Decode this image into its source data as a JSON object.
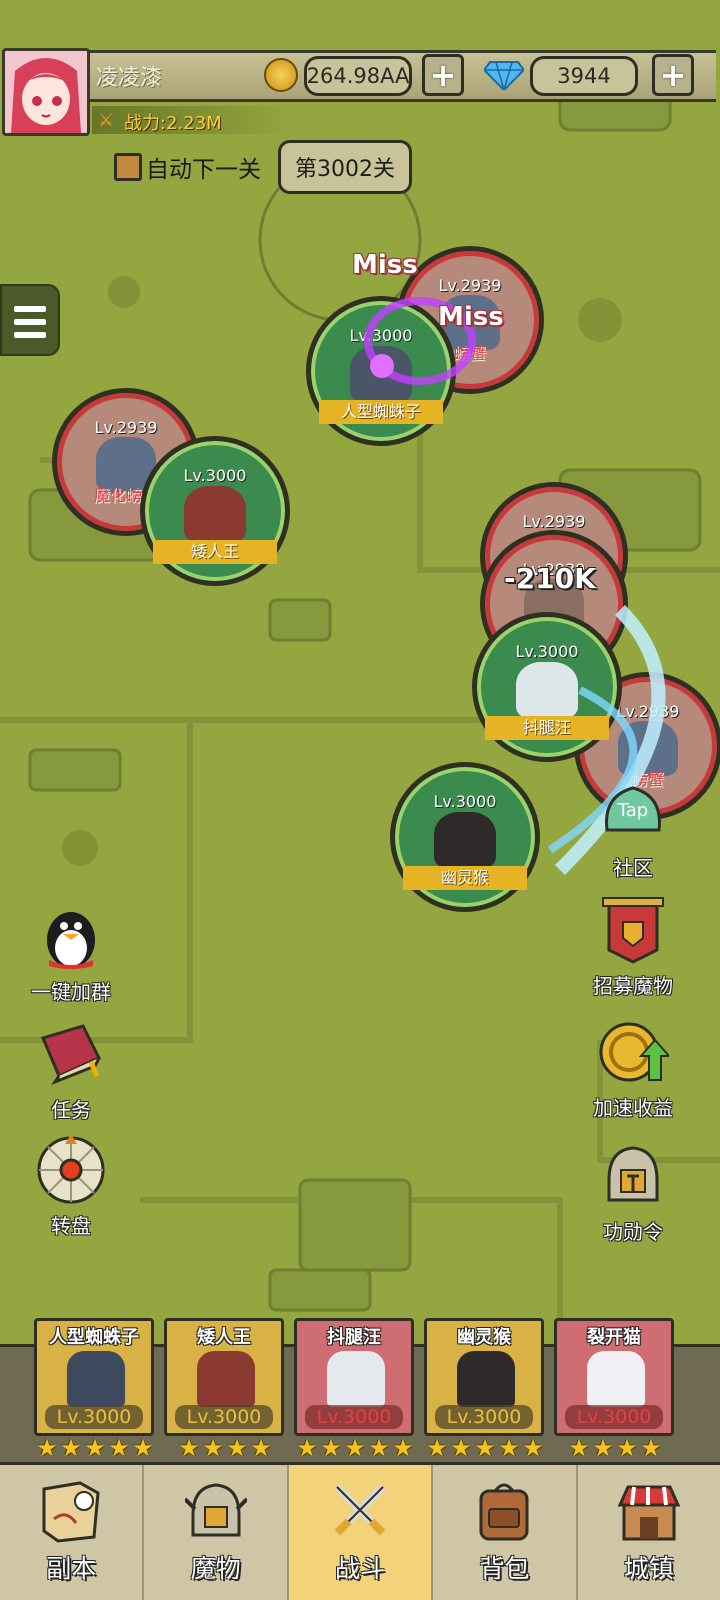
{
  "player": {
    "name": "凌凌漆",
    "power": "战力:2.23M"
  },
  "currency": {
    "gold": "264.98AA",
    "gems": "3944"
  },
  "stage": {
    "auto_next_label": "自动下一关",
    "auto_next_checked": true,
    "current": "第3002关"
  },
  "battle": {
    "allies": [
      {
        "level": "Lv.3000",
        "name": "人型蜘蛛子"
      },
      {
        "level": "Lv.3000",
        "name": "矮人王"
      },
      {
        "level": "Lv.3000",
        "name": "抖腿汪"
      },
      {
        "level": "Lv.3000",
        "name": "幽灵猴"
      }
    ],
    "enemies": [
      {
        "level": "Lv.2939",
        "name": "魔化螃蟹"
      },
      {
        "level": "Lv.2939",
        "name": "螃蟹"
      },
      {
        "level": "Lv.2939",
        "name": ""
      },
      {
        "level": "Lv.2939",
        "name": ""
      },
      {
        "level": "Lv.2939",
        "name": "螃蟹"
      }
    ],
    "float_texts": {
      "miss_1": "Miss",
      "miss_2": "Miss",
      "damage": "-210K"
    }
  },
  "side_left": [
    {
      "label": "一键加群",
      "icon": "penguin-icon"
    },
    {
      "label": "任务",
      "icon": "book-icon"
    },
    {
      "label": "转盘",
      "icon": "wheel-icon"
    }
  ],
  "side_right": [
    {
      "label": "社区",
      "icon": "tap-bubble-icon",
      "badge": "Tap"
    },
    {
      "label": "招募魔物",
      "icon": "banner-icon"
    },
    {
      "label": "加速收益",
      "icon": "coin-boost-icon"
    },
    {
      "label": "功勋令",
      "icon": "helmet-icon"
    }
  ],
  "team": [
    {
      "name": "人型蜘蛛子",
      "level": "Lv.3000",
      "stars": 5
    },
    {
      "name": "矮人王",
      "level": "Lv.3000",
      "stars": 4
    },
    {
      "name": "抖腿汪",
      "level": "Lv.3000",
      "stars": 5
    },
    {
      "name": "幽灵猴",
      "level": "Lv.3000",
      "stars": 5
    },
    {
      "name": "裂开猫",
      "level": "Lv.3000",
      "stars": 4
    }
  ],
  "nav": [
    {
      "label": "副本",
      "icon": "map-icon",
      "active": false
    },
    {
      "label": "魔物",
      "icon": "monster-helmet-icon",
      "active": false
    },
    {
      "label": "战斗",
      "icon": "crossed-swords-icon",
      "active": true
    },
    {
      "label": "背包",
      "icon": "backpack-icon",
      "active": false
    },
    {
      "label": "城镇",
      "icon": "shop-icon",
      "active": false
    }
  ],
  "colors": {
    "map": "#93a63f",
    "ally_ring": "#9bd36a",
    "enemy_ring": "#c83a3a",
    "gold": "#e6b325",
    "active_tab": "#f3d37a"
  }
}
